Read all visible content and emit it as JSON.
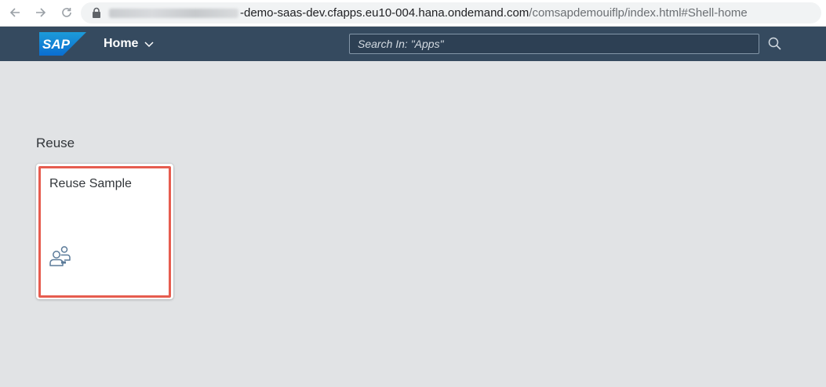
{
  "browser": {
    "url_host": "-demo-saas-dev.cfapps.eu10-004.hana.ondemand.com",
    "url_path": "/comsapdemouiflp/index.html#Shell-home"
  },
  "shell": {
    "logo_text": "SAP",
    "home_label": "Home",
    "search_placeholder": "Search In: \"Apps\""
  },
  "content": {
    "group_title": "Reuse",
    "tiles": [
      {
        "title": "Reuse Sample",
        "icon": "user-group-icon"
      }
    ]
  },
  "colors": {
    "shell_bg": "#354a5f",
    "page_bg": "#e1e3e5",
    "highlight": "#e65c4f"
  }
}
